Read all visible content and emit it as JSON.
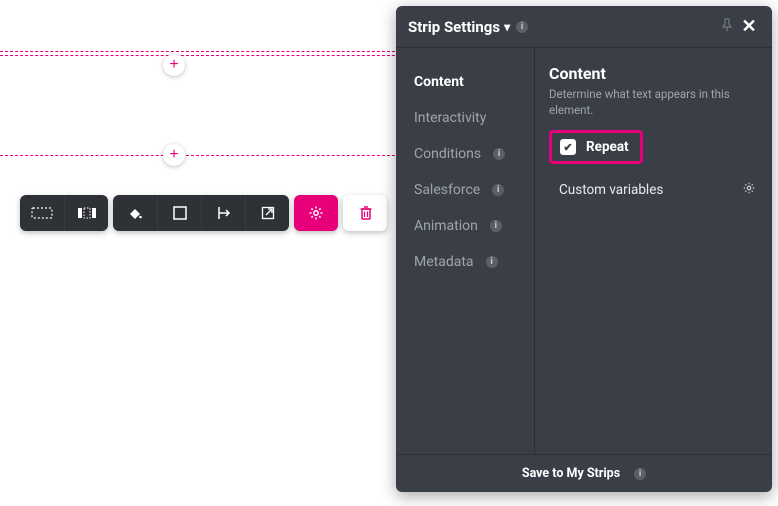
{
  "canvas": {
    "plus_glyph": "+"
  },
  "panel": {
    "title": "Strip Settings",
    "sidebar": {
      "content": "Content",
      "interactivity": "Interactivity",
      "conditions": "Conditions",
      "salesforce": "Salesforce",
      "animation": "Animation",
      "metadata": "Metadata"
    },
    "content": {
      "heading": "Content",
      "description": "Determine what text appears in this element.",
      "repeat_label": "Repeat",
      "custom_vars_label": "Custom variables"
    },
    "footer": "Save to My Strips"
  }
}
